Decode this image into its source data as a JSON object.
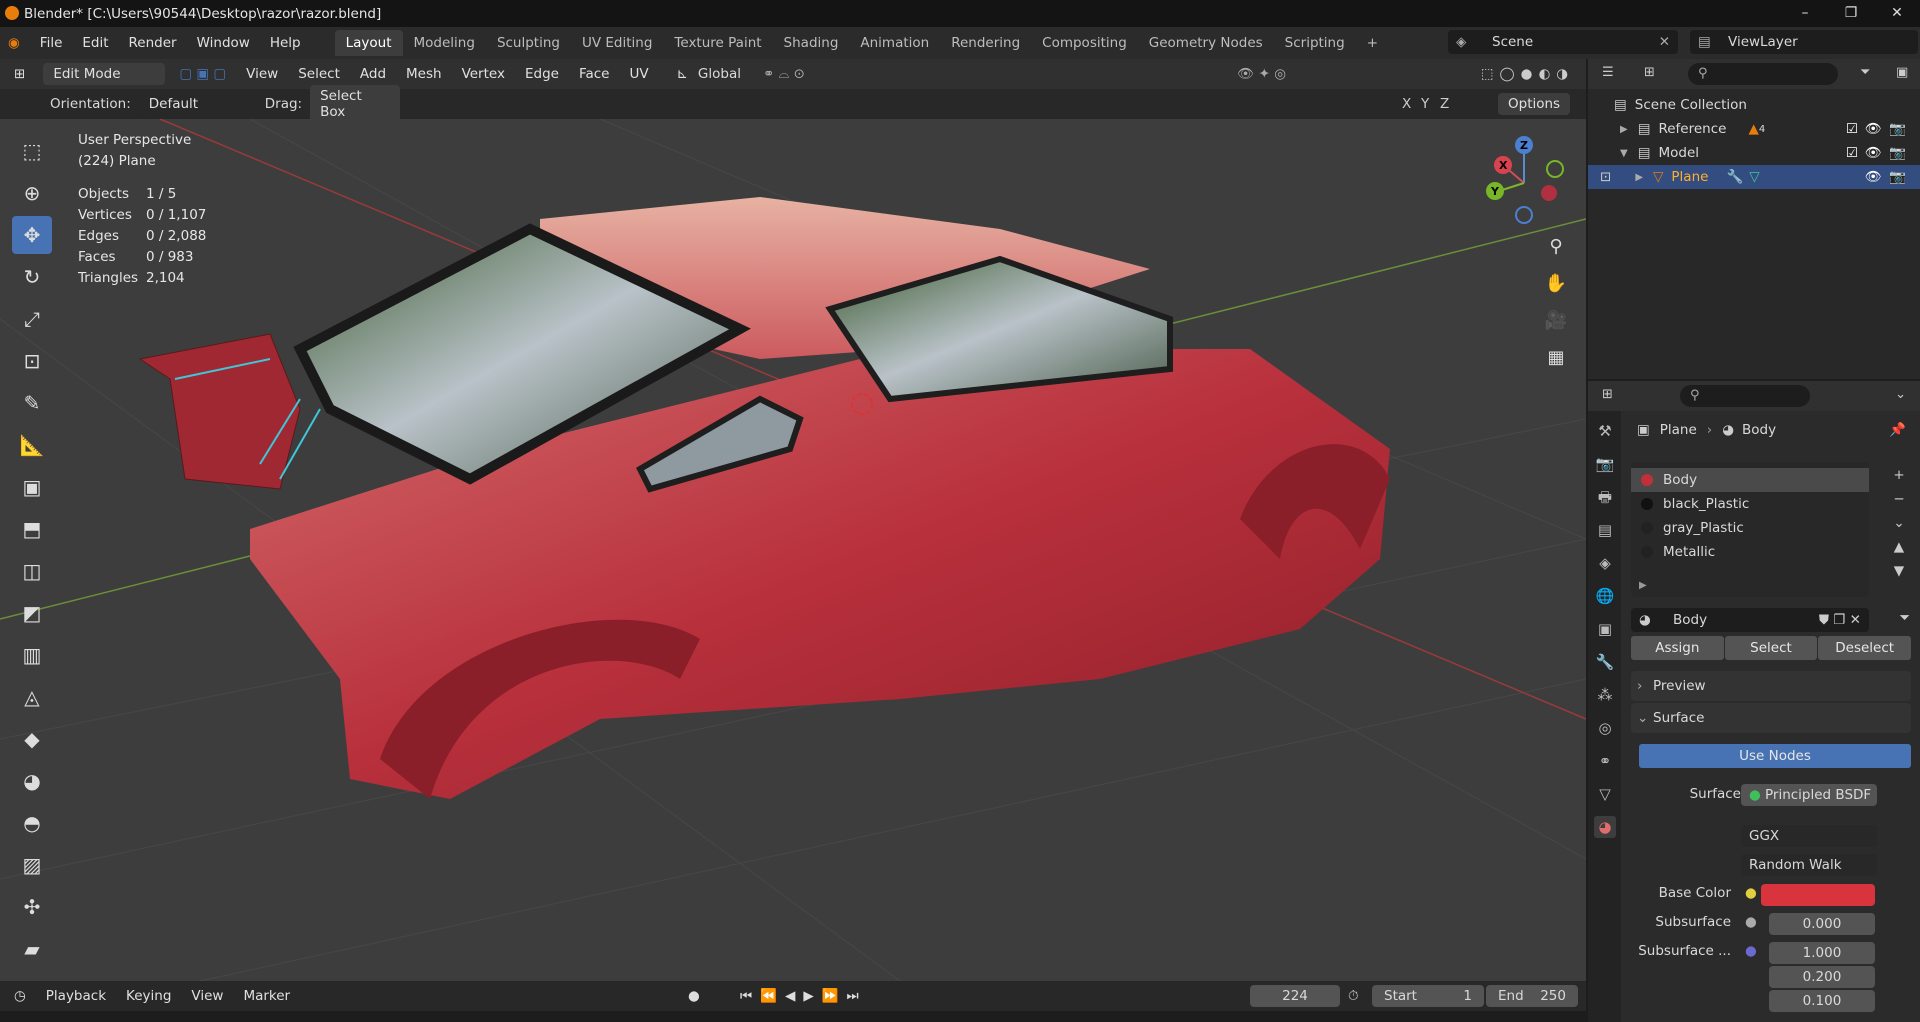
{
  "window": {
    "title": "Blender* [C:\\Users\\90544\\Desktop\\razor\\razor.blend]"
  },
  "menu": [
    "File",
    "Edit",
    "Render",
    "Window",
    "Help"
  ],
  "workspaces": [
    "Layout",
    "Modeling",
    "Sculpting",
    "UV Editing",
    "Texture Paint",
    "Shading",
    "Animation",
    "Rendering",
    "Compositing",
    "Geometry Nodes",
    "Scripting"
  ],
  "scene": "Scene",
  "view_layer": "ViewLayer",
  "viewport_header": {
    "mode": "Edit Mode",
    "menus": [
      "View",
      "Select",
      "Add",
      "Mesh",
      "Vertex",
      "Edge",
      "Face",
      "UV"
    ],
    "transform": "Global"
  },
  "tool_settings": {
    "orientation_label": "Orientation:",
    "orientation": "Default",
    "drag_label": "Drag:",
    "drag": "Select Box",
    "axes": [
      "X",
      "Y",
      "Z"
    ],
    "options": "Options"
  },
  "overlay_info": {
    "view_name": "User Perspective",
    "object": "(224) Plane",
    "stats": [
      {
        "k": "Objects",
        "v": "1 / 5"
      },
      {
        "k": "Vertices",
        "v": "0 / 1,107"
      },
      {
        "k": "Edges",
        "v": "0 / 2,088"
      },
      {
        "k": "Faces",
        "v": "0 / 983"
      },
      {
        "k": "Triangles",
        "v": "2,104"
      }
    ]
  },
  "gizmo_axes": {
    "x": "X",
    "y": "Y",
    "z": "Z"
  },
  "timeline": {
    "menus": [
      "Playback",
      "Keying",
      "View",
      "Marker"
    ],
    "frame": "224",
    "start_label": "Start",
    "start": "1",
    "end_label": "End",
    "end": "250"
  },
  "outliner": {
    "root": "Scene Collection",
    "items": [
      {
        "name": "Reference",
        "badge": "4"
      },
      {
        "name": "Model"
      },
      {
        "name": "Plane"
      }
    ]
  },
  "properties": {
    "breadcrumb": [
      "Plane",
      "Body"
    ],
    "materials": [
      "Body",
      "black_Plastic",
      "gray_Plastic",
      "Metallic"
    ],
    "material_colors": [
      "#c0303a",
      "#1a1a1a",
      "#2a2a2a",
      "#2a2a2a"
    ],
    "active_material": "Body",
    "buttons": {
      "assign": "Assign",
      "select": "Select",
      "deselect": "Deselect"
    },
    "sections": {
      "preview": "Preview",
      "surface": "Surface"
    },
    "use_nodes": "Use Nodes",
    "surface_label": "Surface",
    "surface_shader": "Principled BSDF",
    "distribution": "GGX",
    "subsurface_method": "Random Walk",
    "base_color_label": "Base Color",
    "base_color": "#d9343d",
    "subsurface_label": "Subsurface",
    "subsurface": "0.000",
    "subsurface_radius_label": "Subsurface ...",
    "subsurface_radius": [
      "1.000",
      "0.200",
      "0.100"
    ]
  },
  "colors": {
    "accent": "#4772b3",
    "selected_row": "#334d80",
    "car_body": "#b8303c"
  }
}
